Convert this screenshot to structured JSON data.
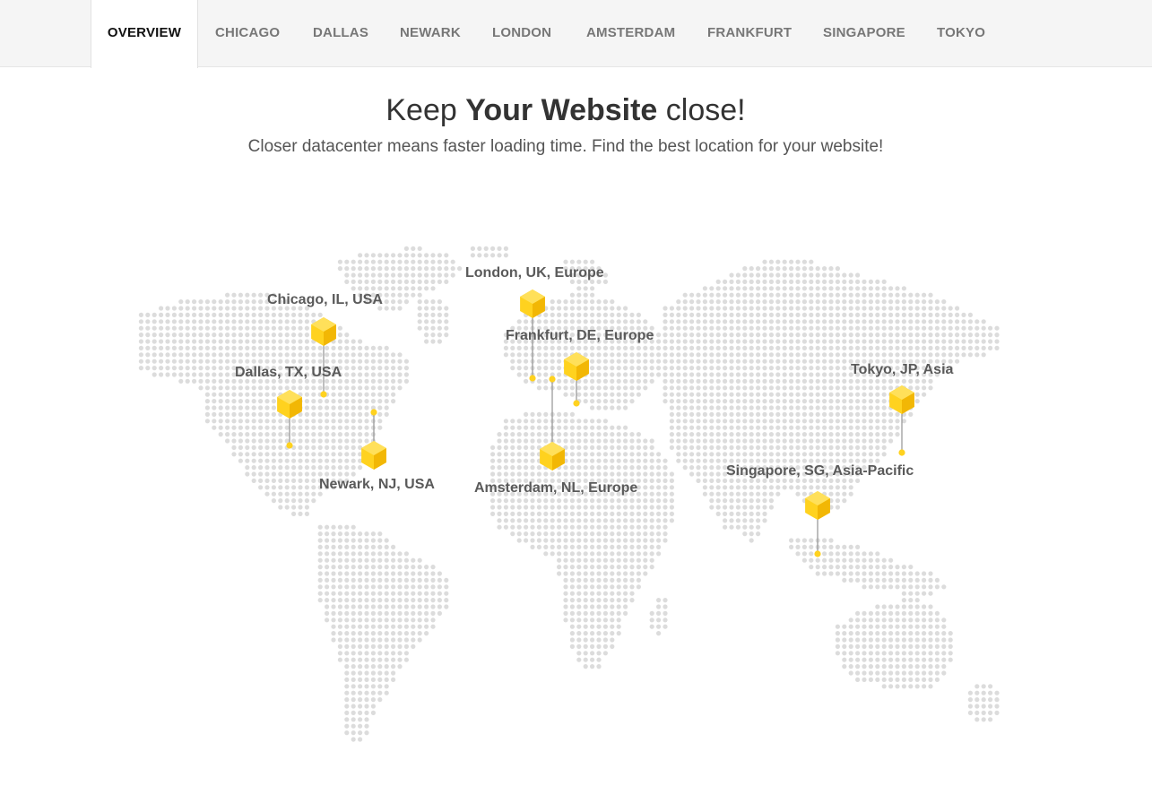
{
  "tabs": [
    {
      "label": "OVERVIEW",
      "active": true
    },
    {
      "label": "CHICAGO",
      "active": false
    },
    {
      "label": "DALLAS",
      "active": false
    },
    {
      "label": "NEWARK",
      "active": false
    },
    {
      "label": "LONDON",
      "active": false
    },
    {
      "label": "AMSTERDAM",
      "active": false
    },
    {
      "label": "FRANKFURT",
      "active": false
    },
    {
      "label": "SINGAPORE",
      "active": false
    },
    {
      "label": "TOKYO",
      "active": false
    }
  ],
  "hero": {
    "title_pre": "Keep ",
    "title_bold": "Your Website",
    "title_post": " close!",
    "subtitle": "Closer datacenter means faster loading time. Find the best location for your website!"
  },
  "map": {
    "dot_color": "#dcdcdc",
    "pin_color": "#ffd21f",
    "locations": [
      {
        "id": "chicago",
        "label": "Chicago, IL, USA"
      },
      {
        "id": "dallas",
        "label": "Dallas, TX, USA"
      },
      {
        "id": "newark",
        "label": "Newark, NJ, USA"
      },
      {
        "id": "london",
        "label": "London, UK, Europe"
      },
      {
        "id": "frankfurt",
        "label": "Frankfurt, DE, Europe"
      },
      {
        "id": "amsterdam",
        "label": "Amsterdam, NL, Europe"
      },
      {
        "id": "tokyo",
        "label": "Tokyo, JP, Asia"
      },
      {
        "id": "singapore",
        "label": "Singapore, SG, Asia-Pacific"
      }
    ]
  }
}
